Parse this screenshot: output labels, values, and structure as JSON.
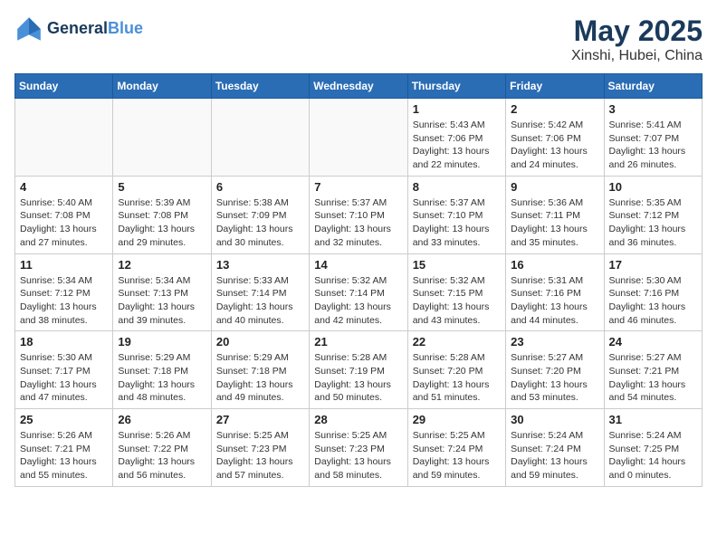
{
  "logo": {
    "line1": "General",
    "line2": "Blue"
  },
  "title": "May 2025",
  "subtitle": "Xinshi, Hubei, China",
  "weekdays": [
    "Sunday",
    "Monday",
    "Tuesday",
    "Wednesday",
    "Thursday",
    "Friday",
    "Saturday"
  ],
  "weeks": [
    [
      {
        "day": "",
        "info": ""
      },
      {
        "day": "",
        "info": ""
      },
      {
        "day": "",
        "info": ""
      },
      {
        "day": "",
        "info": ""
      },
      {
        "day": "1",
        "info": "Sunrise: 5:43 AM\nSunset: 7:06 PM\nDaylight: 13 hours\nand 22 minutes."
      },
      {
        "day": "2",
        "info": "Sunrise: 5:42 AM\nSunset: 7:06 PM\nDaylight: 13 hours\nand 24 minutes."
      },
      {
        "day": "3",
        "info": "Sunrise: 5:41 AM\nSunset: 7:07 PM\nDaylight: 13 hours\nand 26 minutes."
      }
    ],
    [
      {
        "day": "4",
        "info": "Sunrise: 5:40 AM\nSunset: 7:08 PM\nDaylight: 13 hours\nand 27 minutes."
      },
      {
        "day": "5",
        "info": "Sunrise: 5:39 AM\nSunset: 7:08 PM\nDaylight: 13 hours\nand 29 minutes."
      },
      {
        "day": "6",
        "info": "Sunrise: 5:38 AM\nSunset: 7:09 PM\nDaylight: 13 hours\nand 30 minutes."
      },
      {
        "day": "7",
        "info": "Sunrise: 5:37 AM\nSunset: 7:10 PM\nDaylight: 13 hours\nand 32 minutes."
      },
      {
        "day": "8",
        "info": "Sunrise: 5:37 AM\nSunset: 7:10 PM\nDaylight: 13 hours\nand 33 minutes."
      },
      {
        "day": "9",
        "info": "Sunrise: 5:36 AM\nSunset: 7:11 PM\nDaylight: 13 hours\nand 35 minutes."
      },
      {
        "day": "10",
        "info": "Sunrise: 5:35 AM\nSunset: 7:12 PM\nDaylight: 13 hours\nand 36 minutes."
      }
    ],
    [
      {
        "day": "11",
        "info": "Sunrise: 5:34 AM\nSunset: 7:12 PM\nDaylight: 13 hours\nand 38 minutes."
      },
      {
        "day": "12",
        "info": "Sunrise: 5:34 AM\nSunset: 7:13 PM\nDaylight: 13 hours\nand 39 minutes."
      },
      {
        "day": "13",
        "info": "Sunrise: 5:33 AM\nSunset: 7:14 PM\nDaylight: 13 hours\nand 40 minutes."
      },
      {
        "day": "14",
        "info": "Sunrise: 5:32 AM\nSunset: 7:14 PM\nDaylight: 13 hours\nand 42 minutes."
      },
      {
        "day": "15",
        "info": "Sunrise: 5:32 AM\nSunset: 7:15 PM\nDaylight: 13 hours\nand 43 minutes."
      },
      {
        "day": "16",
        "info": "Sunrise: 5:31 AM\nSunset: 7:16 PM\nDaylight: 13 hours\nand 44 minutes."
      },
      {
        "day": "17",
        "info": "Sunrise: 5:30 AM\nSunset: 7:16 PM\nDaylight: 13 hours\nand 46 minutes."
      }
    ],
    [
      {
        "day": "18",
        "info": "Sunrise: 5:30 AM\nSunset: 7:17 PM\nDaylight: 13 hours\nand 47 minutes."
      },
      {
        "day": "19",
        "info": "Sunrise: 5:29 AM\nSunset: 7:18 PM\nDaylight: 13 hours\nand 48 minutes."
      },
      {
        "day": "20",
        "info": "Sunrise: 5:29 AM\nSunset: 7:18 PM\nDaylight: 13 hours\nand 49 minutes."
      },
      {
        "day": "21",
        "info": "Sunrise: 5:28 AM\nSunset: 7:19 PM\nDaylight: 13 hours\nand 50 minutes."
      },
      {
        "day": "22",
        "info": "Sunrise: 5:28 AM\nSunset: 7:20 PM\nDaylight: 13 hours\nand 51 minutes."
      },
      {
        "day": "23",
        "info": "Sunrise: 5:27 AM\nSunset: 7:20 PM\nDaylight: 13 hours\nand 53 minutes."
      },
      {
        "day": "24",
        "info": "Sunrise: 5:27 AM\nSunset: 7:21 PM\nDaylight: 13 hours\nand 54 minutes."
      }
    ],
    [
      {
        "day": "25",
        "info": "Sunrise: 5:26 AM\nSunset: 7:21 PM\nDaylight: 13 hours\nand 55 minutes."
      },
      {
        "day": "26",
        "info": "Sunrise: 5:26 AM\nSunset: 7:22 PM\nDaylight: 13 hours\nand 56 minutes."
      },
      {
        "day": "27",
        "info": "Sunrise: 5:25 AM\nSunset: 7:23 PM\nDaylight: 13 hours\nand 57 minutes."
      },
      {
        "day": "28",
        "info": "Sunrise: 5:25 AM\nSunset: 7:23 PM\nDaylight: 13 hours\nand 58 minutes."
      },
      {
        "day": "29",
        "info": "Sunrise: 5:25 AM\nSunset: 7:24 PM\nDaylight: 13 hours\nand 59 minutes."
      },
      {
        "day": "30",
        "info": "Sunrise: 5:24 AM\nSunset: 7:24 PM\nDaylight: 13 hours\nand 59 minutes."
      },
      {
        "day": "31",
        "info": "Sunrise: 5:24 AM\nSunset: 7:25 PM\nDaylight: 14 hours\nand 0 minutes."
      }
    ]
  ]
}
